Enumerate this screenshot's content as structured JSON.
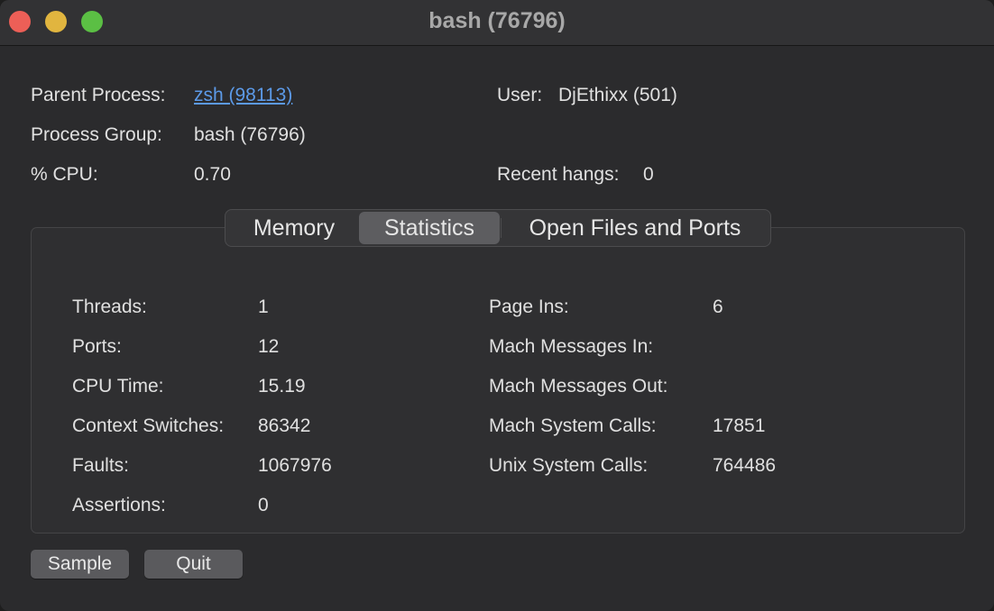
{
  "window": {
    "title": "bash (76796)"
  },
  "info": {
    "parent_process_label": "Parent Process:",
    "parent_process_value": "zsh (98113)",
    "user_label": "User:",
    "user_value": "DjEthixx (501)",
    "process_group_label": "Process Group:",
    "process_group_value": "bash (76796)",
    "cpu_label": "% CPU:",
    "cpu_value": "0.70",
    "recent_hangs_label": "Recent hangs:",
    "recent_hangs_value": "0"
  },
  "tabs": [
    {
      "label": "Memory",
      "active": false
    },
    {
      "label": "Statistics",
      "active": true
    },
    {
      "label": "Open Files and Ports",
      "active": false
    }
  ],
  "stats_left": [
    {
      "label": "Threads:",
      "value": "1"
    },
    {
      "label": "Ports:",
      "value": "12"
    },
    {
      "label": "CPU Time:",
      "value": "15.19"
    },
    {
      "label": "Context Switches:",
      "value": "86342"
    },
    {
      "label": "Faults:",
      "value": "1067976"
    },
    {
      "label": "Assertions:",
      "value": "0"
    }
  ],
  "stats_right": [
    {
      "label": "Page Ins:",
      "value": "6"
    },
    {
      "label": "Mach Messages In:",
      "value": ""
    },
    {
      "label": "Mach Messages Out:",
      "value": ""
    },
    {
      "label": "Mach System Calls:",
      "value": "17851"
    },
    {
      "label": "Unix System Calls:",
      "value": "764486"
    }
  ],
  "buttons": {
    "sample_label": "Sample",
    "quit_label": "Quit"
  }
}
